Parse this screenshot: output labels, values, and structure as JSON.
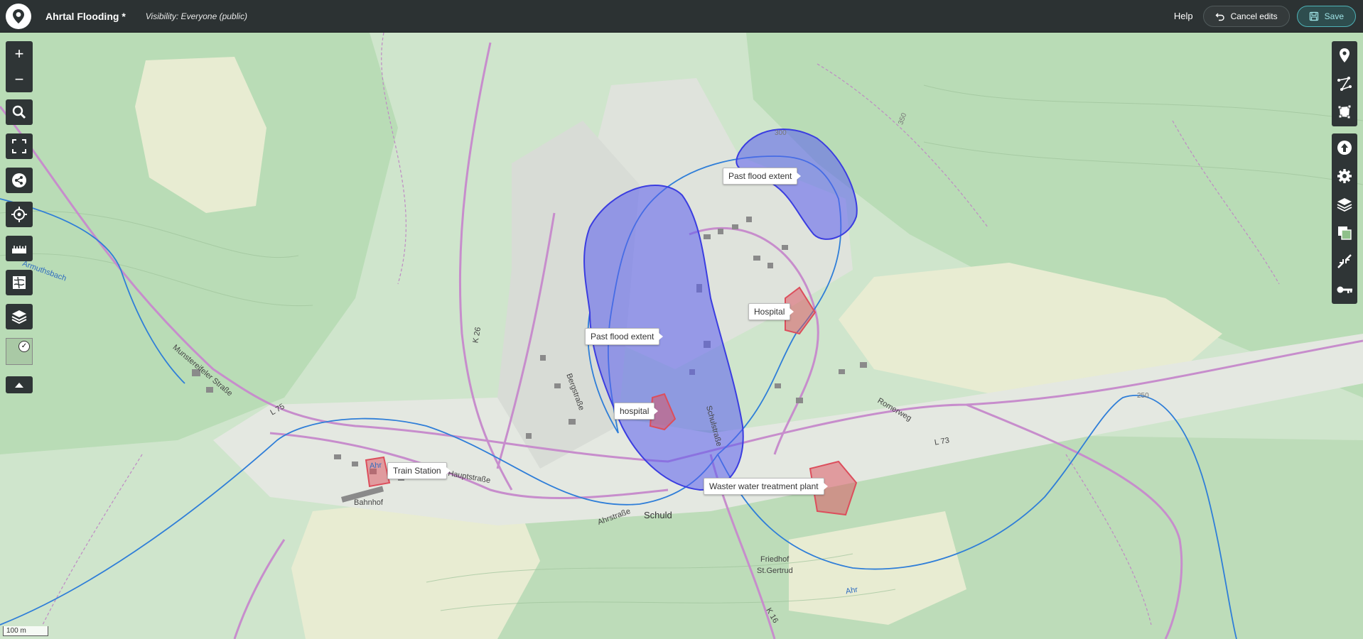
{
  "header": {
    "title": "Ahrtal Flooding *",
    "visibility": "Visibility: Everyone (public)",
    "help_label": "Help",
    "cancel_label": "Cancel edits",
    "save_label": "Save"
  },
  "map": {
    "scale_label": "100 m",
    "feature_labels": {
      "flood_north": "Past flood extent",
      "flood_main": "Past flood extent",
      "hospital_upper": "Hospital",
      "hospital_lower": "hospital",
      "train_station": "Train Station",
      "water_plant": "Waster water treatment plant"
    },
    "basemap_labels": {
      "ahr": "Ahr",
      "l73": "L 73",
      "l75": "L 75",
      "k26": "K 26",
      "k16": "K 16",
      "hauptstrasse": "Hauptstraße",
      "schuld": "Schuld",
      "friedhof": "Friedhof",
      "st_gertrud": "St.Gertrud",
      "romerweg": "Romerweg",
      "armuthsbach": "Armuthsbach",
      "bahnhof": "Bahnhof",
      "schulstrasse": "Schulstraße",
      "bergstrasse": "Bergstraße",
      "ahrstrasse": "Ahrstraße",
      "munstereifeler": "Munstereifeler Straße",
      "elev_250": "250",
      "elev_300": "300",
      "elev_350": "350"
    },
    "colors": {
      "flood": "#5a5cf0",
      "hospital": "#dc4e5c",
      "river": "#2f7ed8",
      "road": "#c88ccc",
      "forest": "#b7dcb4",
      "meadow": "#e9ecd3"
    }
  },
  "controls": {
    "left": [
      "plus-icon",
      "minus-icon",
      "search-icon",
      "fullscreen-icon",
      "share-icon",
      "locate-icon",
      "measure-icon",
      "minimap-icon",
      "layers-icon"
    ],
    "right": [
      "marker-icon",
      "line-icon",
      "polygon-icon",
      "upload-icon",
      "gear-icon",
      "layers-icon",
      "tilelayer-icon",
      "merge-icon",
      "key-icon"
    ]
  }
}
